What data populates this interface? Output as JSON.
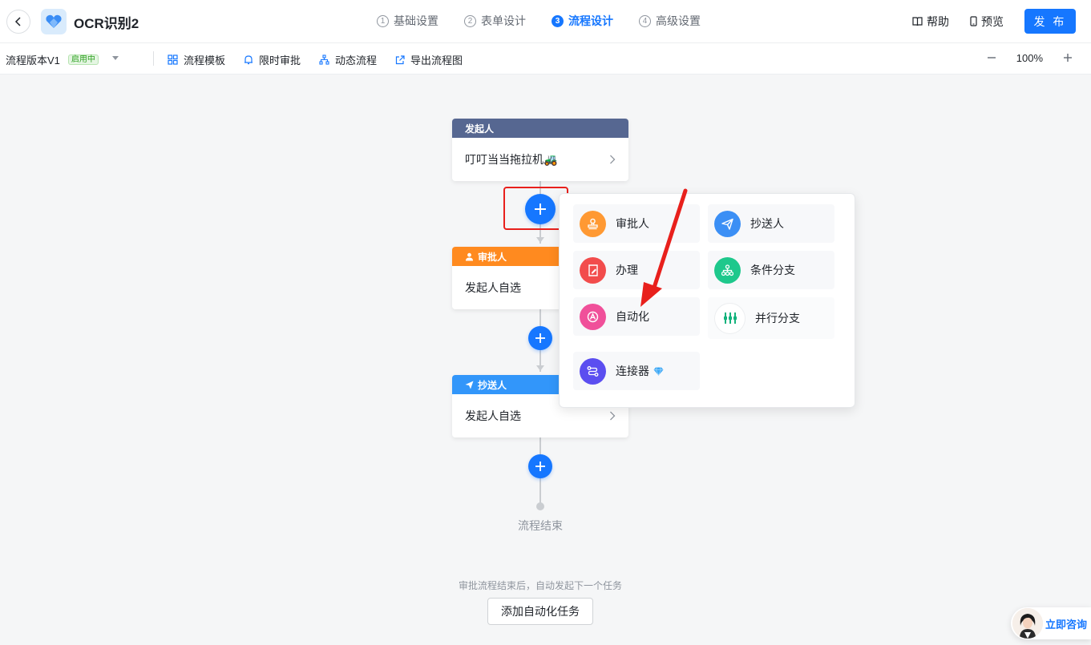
{
  "header": {
    "app_title": "OCR识别2",
    "steps": [
      {
        "num": "1",
        "label": "基础设置"
      },
      {
        "num": "2",
        "label": "表单设计"
      },
      {
        "num": "3",
        "label": "流程设计"
      },
      {
        "num": "4",
        "label": "高级设置"
      }
    ],
    "active_step": 3,
    "help_label": "帮助",
    "preview_label": "预览",
    "publish_label": "发 布"
  },
  "toolbar": {
    "version_label": "流程版本V1",
    "version_status": "启用中",
    "items": [
      "流程模板",
      "限时审批",
      "动态流程",
      "导出流程图"
    ],
    "zoom_value": "100%"
  },
  "flow": {
    "initiator": {
      "head": "发起人",
      "body": "叮叮当当拖拉机🚜"
    },
    "approver": {
      "head": "审批人",
      "body": "发起人自选"
    },
    "cc": {
      "head": "抄送人",
      "body": "发起人自选"
    },
    "end_label": "流程结束",
    "hint": "审批流程结束后，自动发起下一个任务",
    "add_task_label": "添加自动化任务"
  },
  "popover": {
    "options": [
      {
        "label": "审批人",
        "icon": "stamp-icon",
        "color": "#ff9933"
      },
      {
        "label": "抄送人",
        "icon": "send-icon",
        "color": "#3b8ff5"
      },
      {
        "label": "办理",
        "icon": "edit-doc-icon",
        "color": "#f24c4c"
      },
      {
        "label": "条件分支",
        "icon": "branch-icon",
        "color": "#1ec88c"
      },
      {
        "label": "自动化",
        "icon": "automation-icon",
        "color": "#f0509a"
      },
      {
        "label": "并行分支",
        "icon": "parallel-icon",
        "color": "#14b37d"
      },
      {
        "label": "连接器",
        "icon": "connector-icon",
        "color": "#5b4ef0"
      }
    ]
  },
  "consult": {
    "label": "立即咨询"
  },
  "colors": {
    "accent": "#1677ff",
    "initiator_head": "#566791",
    "approver_head": "#ff8a1f",
    "cc_head": "#3296fa",
    "annotation": "#e8201c"
  }
}
